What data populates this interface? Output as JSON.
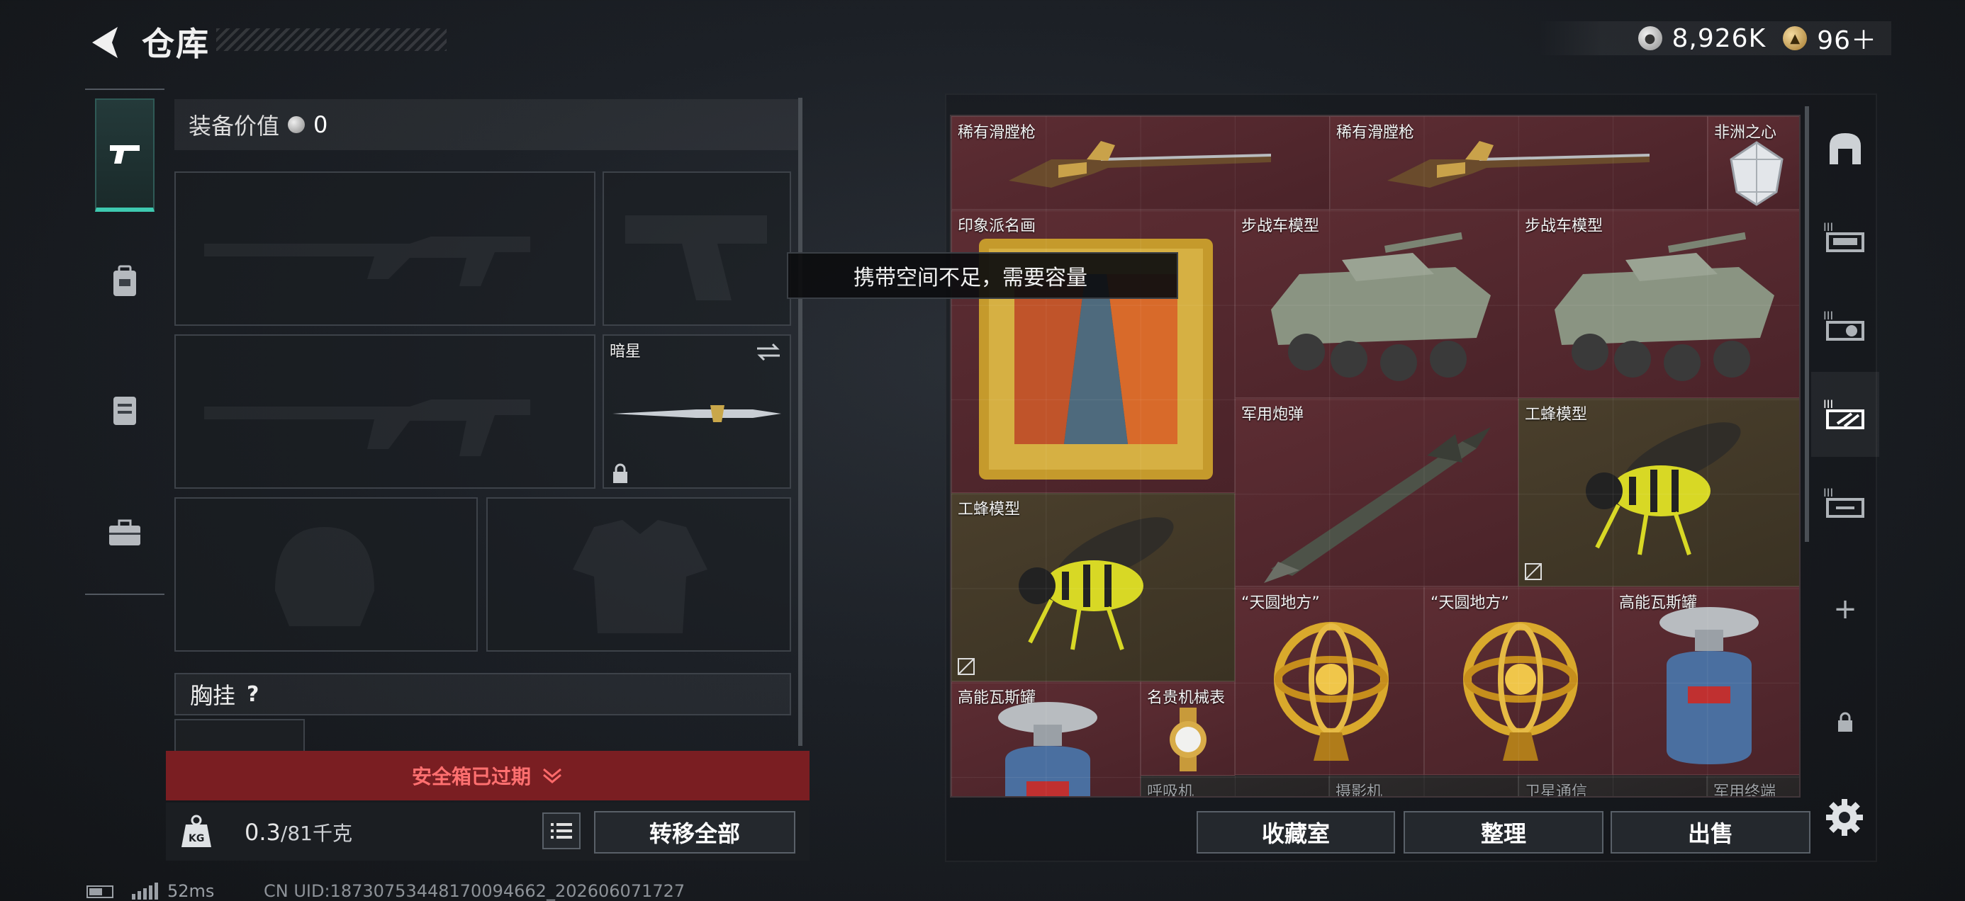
{
  "header": {
    "title": "仓库",
    "currency": [
      {
        "icon": "silver-coin-icon",
        "value": "8,926K"
      },
      {
        "icon": "gold-coin-icon",
        "value": "96＋"
      }
    ]
  },
  "left_nav": {
    "items": [
      {
        "icon": "pistol-icon",
        "active": true
      },
      {
        "icon": "backpack-icon",
        "active": false
      },
      {
        "icon": "bag-icon",
        "active": false
      },
      {
        "icon": "toolbox-icon",
        "active": false
      }
    ]
  },
  "equipment": {
    "value_label": "装备价值",
    "value": "0",
    "melee_label": "暗星",
    "chest_label": "胸挂",
    "chest_help": "?"
  },
  "safebox": {
    "expired_text": "安全箱已过期"
  },
  "bottom_left": {
    "weight_current": "0.3",
    "weight_rest": "/81千克",
    "transfer_all": "转移全部"
  },
  "tooltip": {
    "text": "携带空间不足，需要容量"
  },
  "storage": {
    "items": [
      {
        "label": "稀有滑膛枪",
        "icon": "musket-icon"
      },
      {
        "label": "稀有滑膛枪",
        "icon": "musket-icon"
      },
      {
        "label": "非洲之心",
        "icon": "diamond-icon"
      },
      {
        "label": "印象派名画",
        "icon": "painting-icon"
      },
      {
        "label": "步战车模型",
        "icon": "armored-vehicle-icon"
      },
      {
        "label": "步战车模型",
        "icon": "armored-vehicle-icon"
      },
      {
        "label": "军用炮弹",
        "icon": "missile-icon"
      },
      {
        "label": "工蜂模型",
        "icon": "wasp-model-icon"
      },
      {
        "label": "工蜂模型",
        "icon": "wasp-model-icon"
      },
      {
        "label": "“天圆地方”",
        "icon": "armillary-sphere-icon"
      },
      {
        "label": "“天圆地方”",
        "icon": "armillary-sphere-icon"
      },
      {
        "label": "高能瓦斯罐",
        "icon": "gas-canister-icon"
      },
      {
        "label": "高能瓦斯罐",
        "icon": "gas-canister-icon"
      },
      {
        "label": "名贵机械表",
        "icon": "watch-icon"
      },
      {
        "label": "呼吸机",
        "icon": ""
      },
      {
        "label": "摄影机",
        "icon": ""
      },
      {
        "label": "卫星通信",
        "icon": ""
      },
      {
        "label": "军用终端",
        "icon": ""
      }
    ]
  },
  "right_nav": {
    "items": [
      {
        "icon": "gate-icon"
      },
      {
        "icon": "shelf-1-icon"
      },
      {
        "icon": "shelf-2-icon"
      },
      {
        "icon": "shelf-3-icon",
        "active": true
      },
      {
        "icon": "shelf-4-icon"
      },
      {
        "icon": "add-icon",
        "text": "+"
      },
      {
        "icon": "lock-icon"
      }
    ]
  },
  "bottom_right": {
    "collection": "收藏室",
    "organize": "整理",
    "sell": "出售"
  },
  "footer": {
    "ping": "52ms",
    "uid": "CN UID:18730753448170094662_202606071727"
  },
  "colors": {
    "accent": "#3ec9b0",
    "warning_red": "#7a1e22",
    "rare_red": "#5d2d33",
    "gold_bg": "#4a3f2c"
  }
}
